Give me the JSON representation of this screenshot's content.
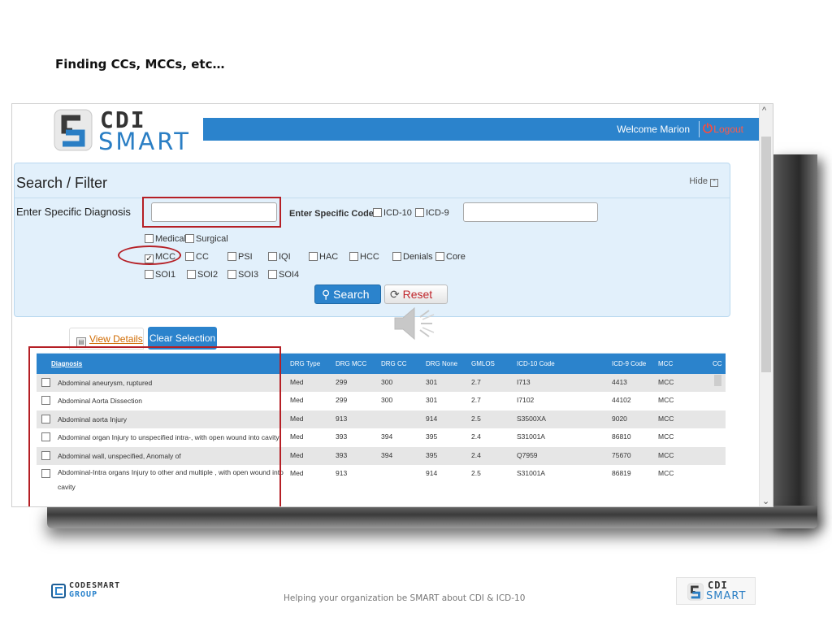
{
  "slide": {
    "title": "Finding CCs, MCCs, etc…",
    "footer_text": "Helping your organization be SMART about CDI & ICD-10",
    "footer_left_logo_line1": "CODESMART",
    "footer_left_logo_line2": "GROUP",
    "footer_right_logo_cdi": "CDI",
    "footer_right_logo_smart": "SMART"
  },
  "app": {
    "logo_cdi": "CDI",
    "logo_smart": "SMART",
    "welcome": "Welcome Marion",
    "logout": "Logout"
  },
  "filter": {
    "title": "Search / Filter",
    "hide_label": "Hide",
    "diagnosis_label": "Enter Specific Diagnosis",
    "diagnosis_value": "",
    "code_label": "Enter Specific Code",
    "code_value": "",
    "code_types": [
      {
        "label": "ICD-10",
        "checked": false
      },
      {
        "label": "ICD-9",
        "checked": false
      }
    ],
    "row1": [
      {
        "label": "Medical",
        "checked": false
      },
      {
        "label": "Surgical",
        "checked": false
      }
    ],
    "row2": [
      {
        "label": "MCC",
        "checked": true
      },
      {
        "label": "CC",
        "checked": false
      },
      {
        "label": "PSI",
        "checked": false
      },
      {
        "label": "IQI",
        "checked": false
      },
      {
        "label": "HAC",
        "checked": false
      },
      {
        "label": "HCC",
        "checked": false
      },
      {
        "label": "Denials",
        "checked": false
      },
      {
        "label": "Core",
        "checked": false
      }
    ],
    "row3": [
      {
        "label": "SOI1",
        "checked": false
      },
      {
        "label": "SOI2",
        "checked": false
      },
      {
        "label": "SOI3",
        "checked": false
      },
      {
        "label": "SOI4",
        "checked": false
      }
    ],
    "search_label": "Search",
    "reset_label": "Reset"
  },
  "actions": {
    "view_details": "View Details",
    "clear_selection": "Clear Selection"
  },
  "table": {
    "headers": [
      "Diagnosis",
      "DRG Type",
      "DRG MCC",
      "DRG CC",
      "DRG None",
      "GMLOS",
      "ICD-10 Code",
      "ICD-9 Code",
      "MCC",
      "CC"
    ],
    "rows": [
      {
        "diagnosis": "Abdominal aneurysm, ruptured",
        "drg_type": "Med",
        "drg_mcc": "299",
        "drg_cc": "300",
        "drg_none": "301",
        "gmlos": "2.7",
        "icd10": "I713",
        "icd9": "4413",
        "mcc": "MCC",
        "cc": ""
      },
      {
        "diagnosis": "Abdominal Aorta Dissection",
        "drg_type": "Med",
        "drg_mcc": "299",
        "drg_cc": "300",
        "drg_none": "301",
        "gmlos": "2.7",
        "icd10": "I7102",
        "icd9": "44102",
        "mcc": "MCC",
        "cc": ""
      },
      {
        "diagnosis": "Abdominal aorta Injury",
        "drg_type": "Med",
        "drg_mcc": "913",
        "drg_cc": "",
        "drg_none": "914",
        "gmlos": "2.5",
        "icd10": "S3500XA",
        "icd9": "9020",
        "mcc": "MCC",
        "cc": ""
      },
      {
        "diagnosis": "Abdominal organ Injury to unspecified intra-, with open wound into cavity",
        "drg_type": "Med",
        "drg_mcc": "393",
        "drg_cc": "394",
        "drg_none": "395",
        "gmlos": "2.4",
        "icd10": "S31001A",
        "icd9": "86810",
        "mcc": "MCC",
        "cc": ""
      },
      {
        "diagnosis": "Abdominal wall, unspecified, Anomaly of",
        "drg_type": "Med",
        "drg_mcc": "393",
        "drg_cc": "394",
        "drg_none": "395",
        "gmlos": "2.4",
        "icd10": "Q7959",
        "icd9": "75670",
        "mcc": "MCC",
        "cc": ""
      },
      {
        "diagnosis": "Abdominal-Intra organs Injury to other and multiple , with open wound into cavity",
        "drg_type": "Med",
        "drg_mcc": "913",
        "drg_cc": "",
        "drg_none": "914",
        "gmlos": "2.5",
        "icd10": "S31001A",
        "icd9": "86819",
        "mcc": "MCC",
        "cc": ""
      }
    ]
  },
  "colors": {
    "accent": "#2b83cc",
    "highlight_red": "#b51f25",
    "panel_bg": "#e2f0fb",
    "logout": "#ff5a4a"
  },
  "icons": [
    "power-icon",
    "search-icon",
    "refresh-icon",
    "speaker-icon",
    "document-icon",
    "collapse-icon",
    "scroll-up-icon",
    "scroll-down-icon"
  ]
}
